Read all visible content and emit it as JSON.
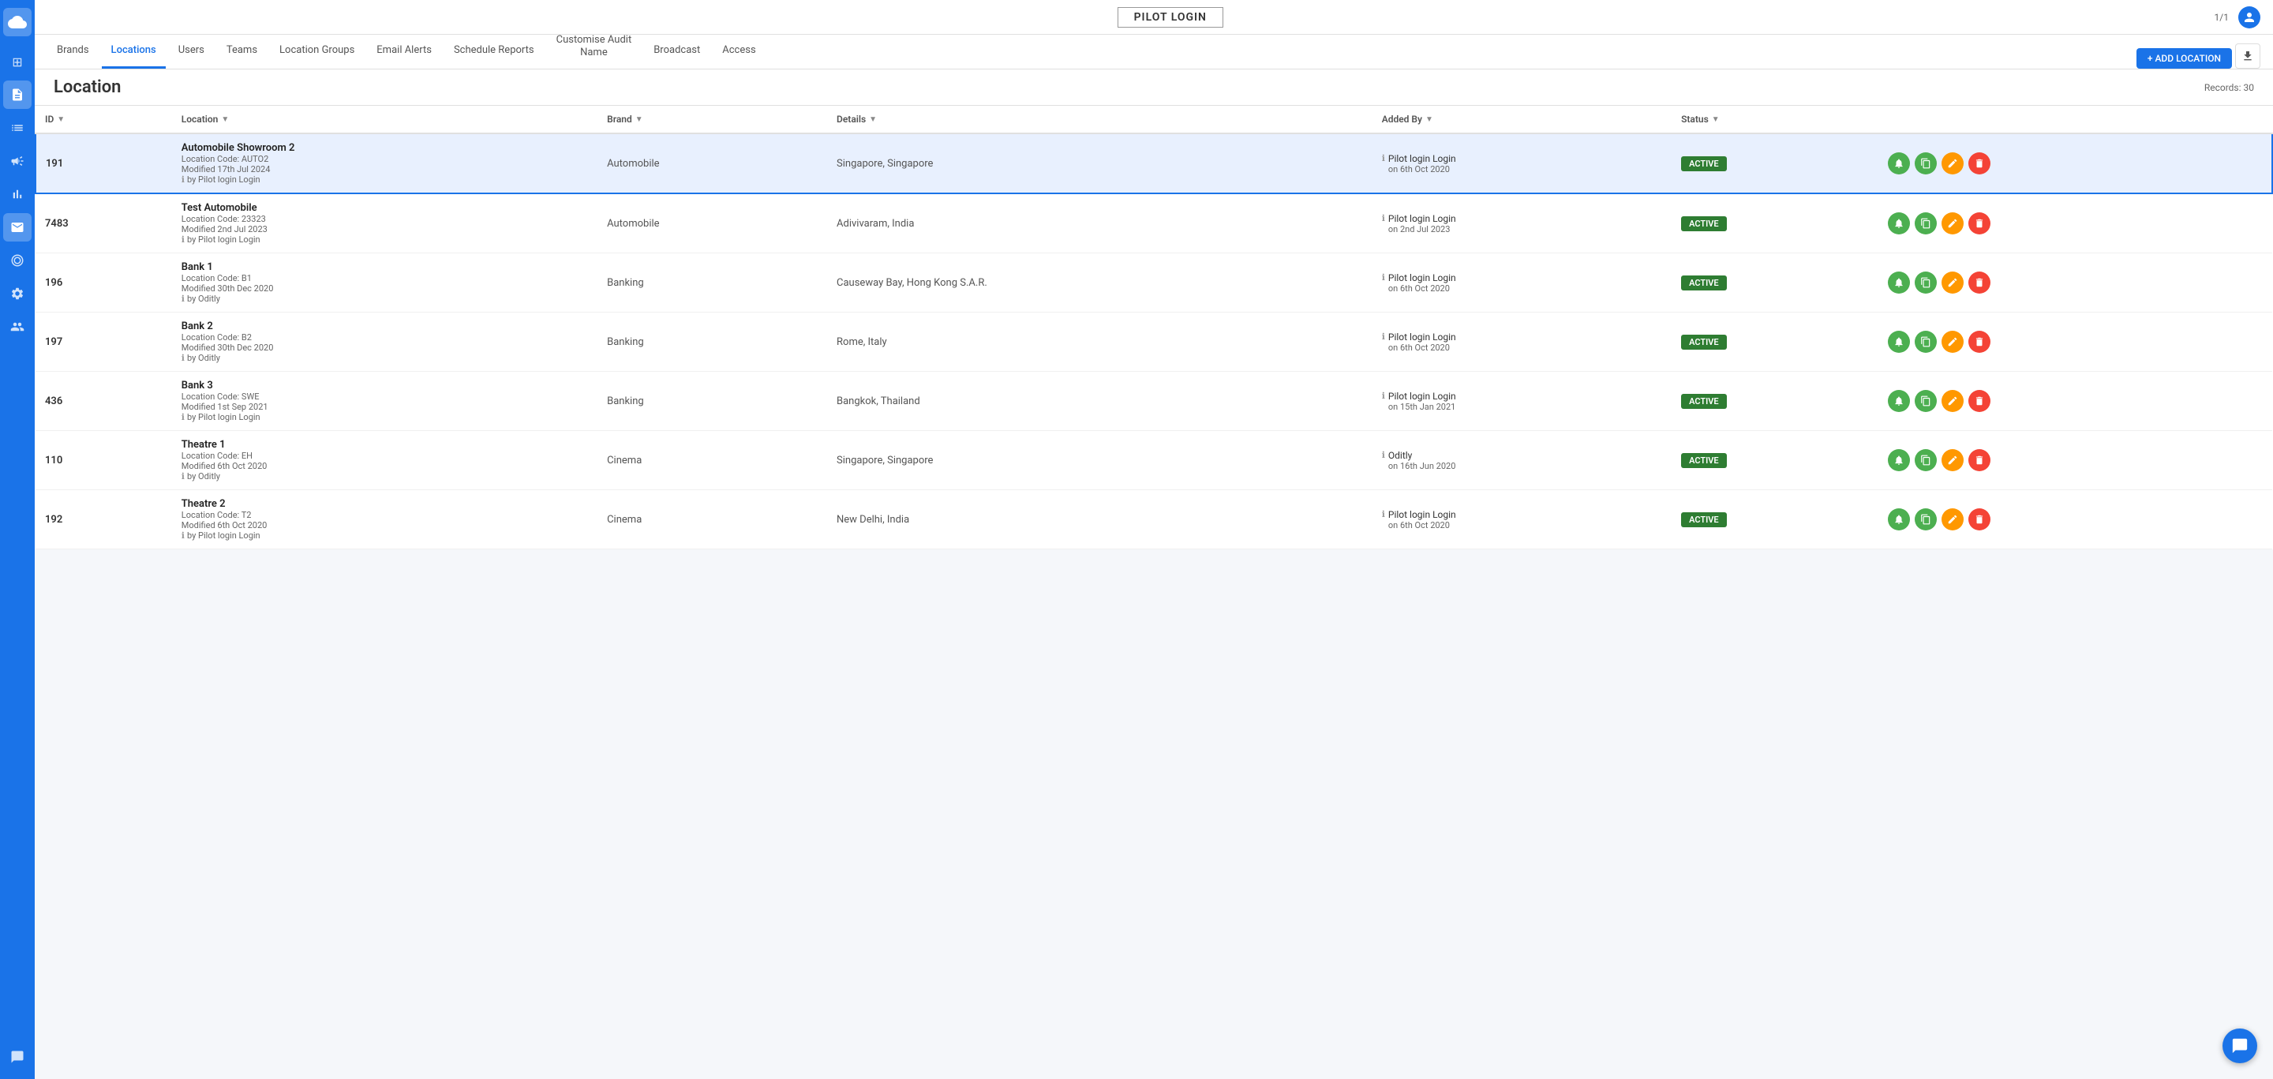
{
  "app": {
    "title": "PILOT LOGIN",
    "page_info": "1/1",
    "records_count": "Records: 30"
  },
  "sidebar": {
    "icons": [
      {
        "name": "cloud-icon",
        "symbol": "☁",
        "active": true
      },
      {
        "name": "grid-icon",
        "symbol": "⊞",
        "active": false
      },
      {
        "name": "document-icon",
        "symbol": "📋",
        "active": false
      },
      {
        "name": "document2-icon",
        "symbol": "📄",
        "active": false
      },
      {
        "name": "megaphone-icon",
        "symbol": "📣",
        "active": false
      },
      {
        "name": "chart-icon",
        "symbol": "📊",
        "active": false
      },
      {
        "name": "envelope-icon",
        "symbol": "✉",
        "active": true
      },
      {
        "name": "target-icon",
        "symbol": "◎",
        "active": false
      },
      {
        "name": "gear-icon",
        "symbol": "⚙",
        "active": false
      },
      {
        "name": "user-icon",
        "symbol": "👤",
        "active": false
      },
      {
        "name": "chat-sidebar-icon",
        "symbol": "💬",
        "active": false
      }
    ]
  },
  "nav": {
    "tabs": [
      {
        "id": "brands",
        "label": "Brands",
        "active": false
      },
      {
        "id": "locations",
        "label": "Locations",
        "active": true
      },
      {
        "id": "users",
        "label": "Users",
        "active": false
      },
      {
        "id": "teams",
        "label": "Teams",
        "active": false
      },
      {
        "id": "location-groups",
        "label": "Location Groups",
        "active": false
      },
      {
        "id": "email-alerts",
        "label": "Email Alerts",
        "active": false
      },
      {
        "id": "schedule-reports",
        "label": "Schedule Reports",
        "active": false
      },
      {
        "id": "customise-audit-name",
        "label1": "Customise Audit",
        "label2": "Name",
        "active": false,
        "multi": true
      },
      {
        "id": "broadcast",
        "label": "Broadcast",
        "active": false
      },
      {
        "id": "access",
        "label": "Access",
        "active": false
      }
    ]
  },
  "content": {
    "title": "Location",
    "add_button": "+ ADD LOCATION",
    "records": "Records: 30"
  },
  "table": {
    "columns": [
      {
        "id": "id",
        "label": "ID"
      },
      {
        "id": "location",
        "label": "Location"
      },
      {
        "id": "brand",
        "label": "Brand"
      },
      {
        "id": "details",
        "label": "Details"
      },
      {
        "id": "added_by",
        "label": "Added By"
      },
      {
        "id": "status",
        "label": "Status"
      }
    ],
    "rows": [
      {
        "id": "191",
        "location_name": "Automobile Showroom 2",
        "location_code": "Location Code: AUTO2",
        "modified": "Modified 17th Jul 2024",
        "by": "by Pilot login Login",
        "brand": "Automobile",
        "details": "Singapore, Singapore",
        "added_by_name": "Pilot login Login",
        "added_by_date": "on 6th Oct 2020",
        "status": "ACTIVE",
        "selected": true
      },
      {
        "id": "7483",
        "location_name": "Test Automobile",
        "location_code": "Location Code: 23323",
        "modified": "Modified 2nd Jul 2023",
        "by": "by Pilot login Login",
        "brand": "Automobile",
        "details": "Adivivaram, India",
        "added_by_name": "Pilot login Login",
        "added_by_date": "on 2nd Jul 2023",
        "status": "ACTIVE",
        "selected": false
      },
      {
        "id": "196",
        "location_name": "Bank 1",
        "location_code": "Location Code: B1",
        "modified": "Modified 30th Dec 2020",
        "by": "by Oditly",
        "brand": "Banking",
        "details": "Causeway Bay, Hong Kong S.A.R.",
        "added_by_name": "Pilot login Login",
        "added_by_date": "on 6th Oct 2020",
        "status": "ACTIVE",
        "selected": false
      },
      {
        "id": "197",
        "location_name": "Bank 2",
        "location_code": "Location Code: B2",
        "modified": "Modified 30th Dec 2020",
        "by": "by Oditly",
        "brand": "Banking",
        "details": "Rome, Italy",
        "added_by_name": "Pilot login Login",
        "added_by_date": "on 6th Oct 2020",
        "status": "ACTIVE",
        "selected": false
      },
      {
        "id": "436",
        "location_name": "Bank 3",
        "location_code": "Location Code: SWE",
        "modified": "Modified 1st Sep 2021",
        "by": "by Pilot login Login",
        "brand": "Banking",
        "details": "Bangkok, Thailand",
        "added_by_name": "Pilot login Login",
        "added_by_date": "on 15th Jan 2021",
        "status": "ACTIVE",
        "selected": false
      },
      {
        "id": "110",
        "location_name": "Theatre 1",
        "location_code": "Location Code: EH",
        "modified": "Modified 6th Oct 2020",
        "by": "by Oditly",
        "brand": "Cinema",
        "details": "Singapore, Singapore",
        "added_by_name": "Oditly",
        "added_by_date": "on 16th Jun 2020",
        "status": "ACTIVE",
        "selected": false
      },
      {
        "id": "192",
        "location_name": "Theatre 2",
        "location_code": "Location Code: T2",
        "modified": "Modified 6th Oct 2020",
        "by": "by Pilot login Login",
        "brand": "Cinema",
        "details": "New Delhi, India",
        "added_by_name": "Pilot login Login",
        "added_by_date": "on 6th Oct 2020",
        "status": "ACTIVE",
        "selected": false
      }
    ]
  },
  "chat": {
    "symbol": "💬"
  }
}
